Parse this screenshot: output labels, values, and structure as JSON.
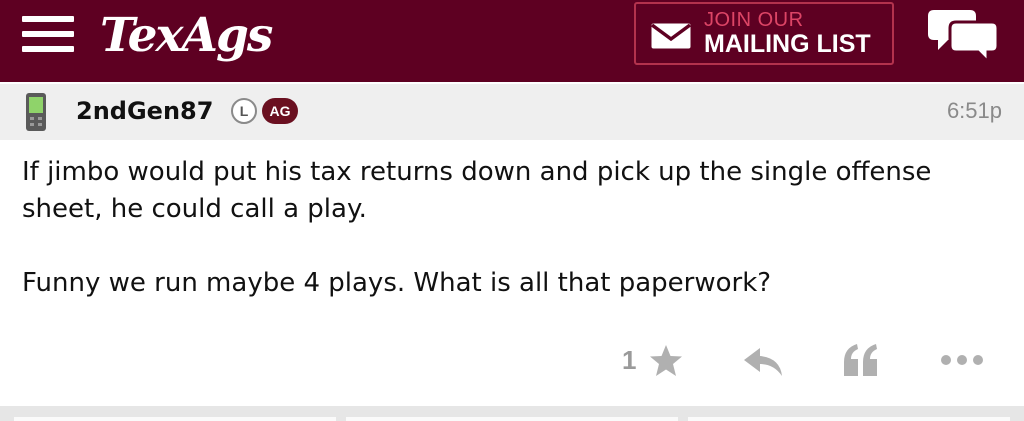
{
  "header": {
    "logo_text": "TexAgs",
    "mailing_line1": "JOIN OUR",
    "mailing_line2": "MAILING LIST",
    "icons": [
      "menu-icon",
      "envelope-icon",
      "chat-icon"
    ]
  },
  "post": {
    "username": "2ndGen87",
    "badge_l": "L",
    "badge_ag": "AG",
    "time": "6:51p",
    "paragraphs": [
      "If jimbo would put his tax returns down and pick up the single offense sheet, he could call a play.",
      "Funny we run maybe 4 plays. What is all that paperwork?"
    ],
    "like_count": "1",
    "action_icons": [
      "star-icon",
      "reply-icon",
      "quote-icon",
      "more-icon"
    ]
  },
  "colors": {
    "brand": "#5e0022",
    "accent": "#dd4566",
    "badge_ag": "#6a1020",
    "muted": "#9a9a9a"
  }
}
